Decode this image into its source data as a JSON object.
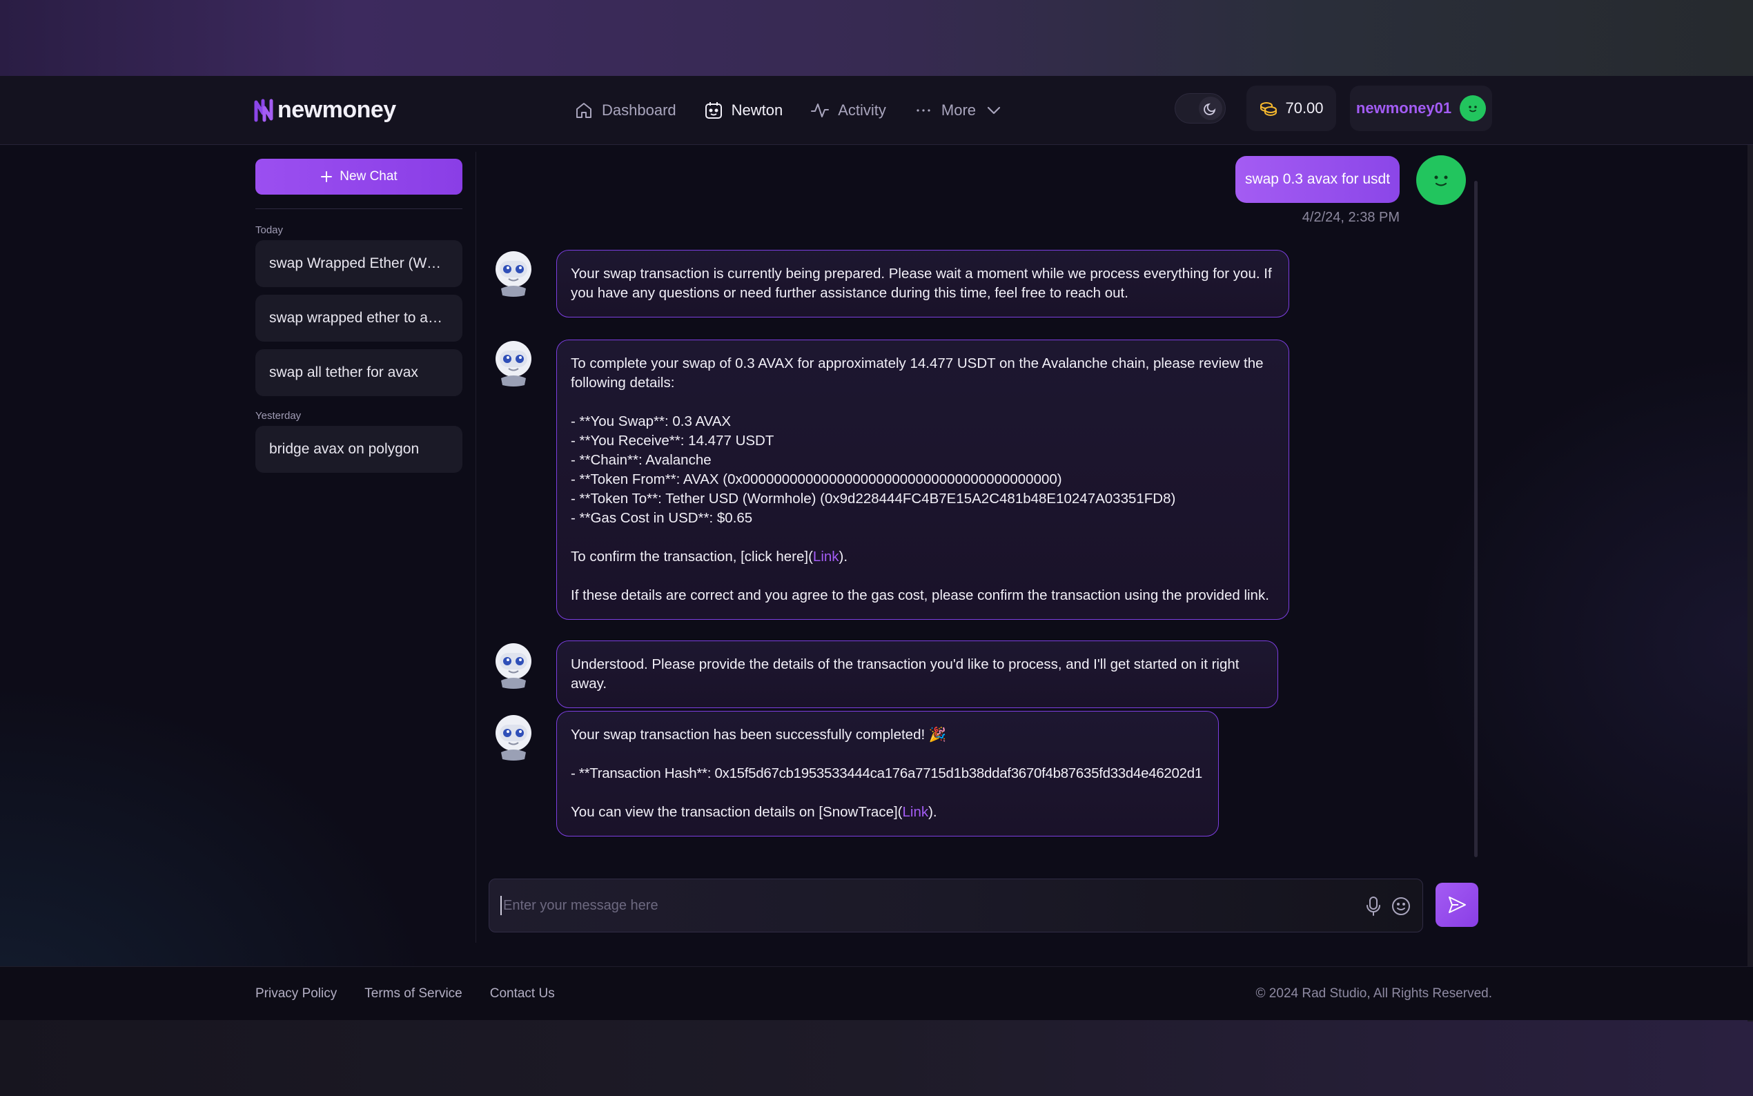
{
  "app": {
    "brand": "newmoney"
  },
  "nav": {
    "items": [
      {
        "label": "Dashboard",
        "icon": "home-icon"
      },
      {
        "label": "Newton",
        "icon": "robot-calendar-icon",
        "active": true
      },
      {
        "label": "Activity",
        "icon": "activity-icon"
      },
      {
        "label": "More",
        "icon": "more-icon"
      }
    ]
  },
  "header": {
    "theme": "dark",
    "balance": "70.00",
    "username": "newmoney01"
  },
  "sidebar": {
    "new_chat_label": "New Chat",
    "sections": [
      {
        "label": "Today",
        "items": [
          "swap Wrapped Ether (Wor...",
          "swap wrapped ether to avax",
          "swap all tether for avax"
        ]
      },
      {
        "label": "Yesterday",
        "items": [
          "bridge avax on polygon"
        ]
      }
    ]
  },
  "chat": {
    "user_message": {
      "text": "swap 0.3 avax for usdt",
      "time": "4/2/24, 2:38 PM"
    },
    "bot_messages": [
      {
        "lines": [
          "Your swap transaction is currently being prepared. Please wait a moment while we process everything for you. If",
          "you have any questions or need further assistance during this time, feel free to reach out."
        ]
      },
      {
        "intro": [
          "To complete your swap of 0.3 AVAX for approximately 14.477 USDT on the Avalanche chain, please review the",
          "following details:"
        ],
        "details": [
          "- **You Swap**: 0.3 AVAX",
          "- **You Receive**: 14.477 USDT",
          "- **Chain**: Avalanche",
          "- **Token From**: AVAX (0x0000000000000000000000000000000000000000)",
          "- **Token To**: Tether USD (Wormhole) (0x9d228444FC4B7E15A2C481b48E10247A03351FD8)",
          "- **Gas Cost in USD**: $0.65"
        ],
        "confirm_prefix": "To confirm the transaction, [click here](",
        "confirm_link": "Link",
        "confirm_suffix": ").",
        "outro": "If these details are correct and you agree to the gas cost, please confirm the transaction using the provided link."
      },
      {
        "lines": [
          "Understood. Please provide the details of the transaction you'd like to process, and I'll get started on it right away."
        ]
      },
      {
        "line1": "Your swap transaction has been successfully completed! 🎉",
        "hash": "- **Transaction Hash**: 0x15f5d67cb1953533444ca176a7715d1b38ddaf3670f4b87635fd33d4e46202d1",
        "view_prefix": "You can view the transaction details on [SnowTrace](",
        "view_link": "Link",
        "view_suffix": ")."
      }
    ]
  },
  "composer": {
    "placeholder": "Enter your message here"
  },
  "footer": {
    "links": [
      "Privacy Policy",
      "Terms of Service",
      "Contact Us"
    ],
    "copyright": "© 2024 Rad Studio, All Rights Reserved."
  },
  "colors": {
    "accent": "#9b4ff0",
    "avatar_green": "#22c55e",
    "bubble_border": "#7c3ee0"
  }
}
